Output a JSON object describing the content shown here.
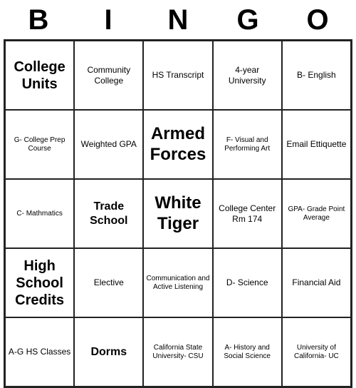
{
  "title": {
    "letters": [
      "B",
      "I",
      "N",
      "G",
      "O"
    ]
  },
  "cells": [
    {
      "text": "College Units",
      "size": "large"
    },
    {
      "text": "Community College",
      "size": "normal"
    },
    {
      "text": "HS Transcript",
      "size": "normal"
    },
    {
      "text": "4-year University",
      "size": "normal"
    },
    {
      "text": "B- English",
      "size": "normal"
    },
    {
      "text": "G- College Prep Course",
      "size": "small"
    },
    {
      "text": "Weighted GPA",
      "size": "normal"
    },
    {
      "text": "Armed Forces",
      "size": "xlarge"
    },
    {
      "text": "F- Visual and Performing Art",
      "size": "small"
    },
    {
      "text": "Email Ettiquette",
      "size": "normal"
    },
    {
      "text": "C- Mathmatics",
      "size": "small"
    },
    {
      "text": "Trade School",
      "size": "medium"
    },
    {
      "text": "White Tiger",
      "size": "xlarge"
    },
    {
      "text": "College Center Rm 174",
      "size": "normal"
    },
    {
      "text": "GPA- Grade Point Average",
      "size": "small"
    },
    {
      "text": "High School Credits",
      "size": "large"
    },
    {
      "text": "Elective",
      "size": "normal"
    },
    {
      "text": "Communication and Active Listening",
      "size": "small"
    },
    {
      "text": "D- Science",
      "size": "normal"
    },
    {
      "text": "Financial Aid",
      "size": "normal"
    },
    {
      "text": "A-G HS Classes",
      "size": "normal"
    },
    {
      "text": "Dorms",
      "size": "medium"
    },
    {
      "text": "California State University- CSU",
      "size": "small"
    },
    {
      "text": "A- History and Social Science",
      "size": "small"
    },
    {
      "text": "University of California- UC",
      "size": "small"
    }
  ]
}
